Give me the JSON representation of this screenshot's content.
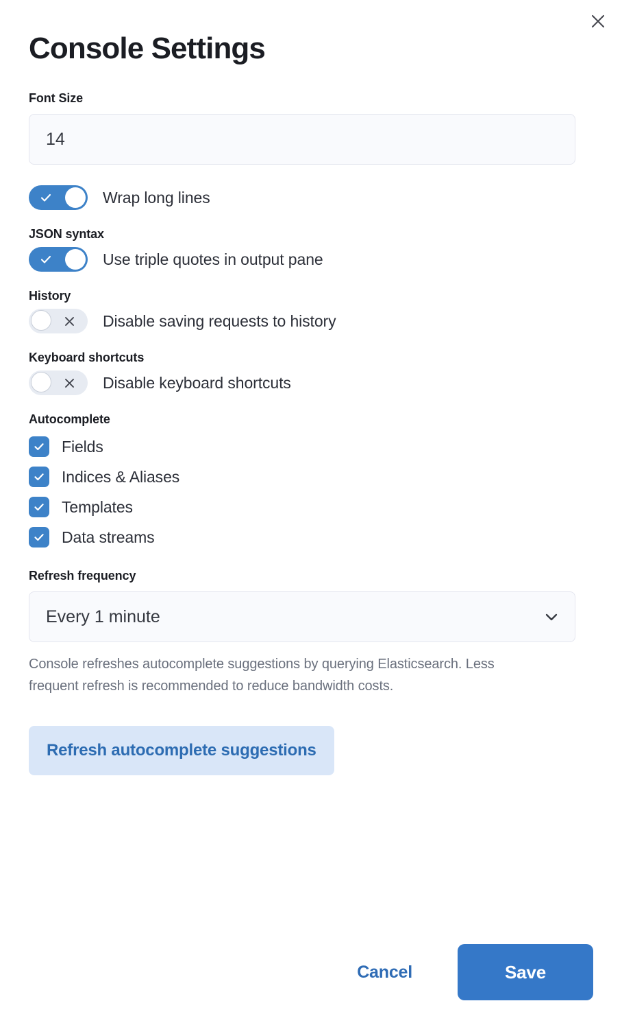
{
  "dialog": {
    "title": "Console Settings",
    "close_icon": "close-icon"
  },
  "font_size": {
    "label": "Font Size",
    "value": "14",
    "placeholder": "Font size"
  },
  "wrap_lines": {
    "label": "Wrap long lines",
    "state": "on"
  },
  "json_syntax": {
    "group_label": "JSON syntax",
    "label": "Use triple quotes in output pane",
    "state": "on"
  },
  "history": {
    "group_label": "History",
    "label": "Disable saving requests to history",
    "state": "off"
  },
  "keyboard_shortcuts": {
    "group_label": "Keyboard shortcuts",
    "label": "Disable keyboard shortcuts",
    "state": "off"
  },
  "autocomplete": {
    "group_label": "Autocomplete",
    "options": [
      {
        "label": "Fields",
        "checked": true
      },
      {
        "label": "Indices & Aliases",
        "checked": true
      },
      {
        "label": "Templates",
        "checked": true
      },
      {
        "label": "Data streams",
        "checked": true
      }
    ]
  },
  "refresh_frequency": {
    "group_label": "Refresh frequency",
    "selected": "Every 1 minute",
    "chevron_icon": "chevron-down-icon",
    "helper_text": "Console refreshes autocomplete suggestions by querying Elasticsearch. Less frequent refresh is recommended to reduce bandwidth costs.",
    "refresh_button_label": "Refresh autocomplete suggestions"
  },
  "footer": {
    "cancel_label": "Cancel",
    "save_label": "Save"
  },
  "colors": {
    "accent_blue": "#3578c8",
    "toggle_on": "#3d82c8",
    "toggle_off": "#e7ebf2",
    "checkbox": "#3d82c8",
    "soft_blue_bg": "#d9e6f8",
    "soft_blue_text": "#2d6cb2",
    "input_bg": "#f9fafd",
    "helper_text": "#6a707d"
  }
}
